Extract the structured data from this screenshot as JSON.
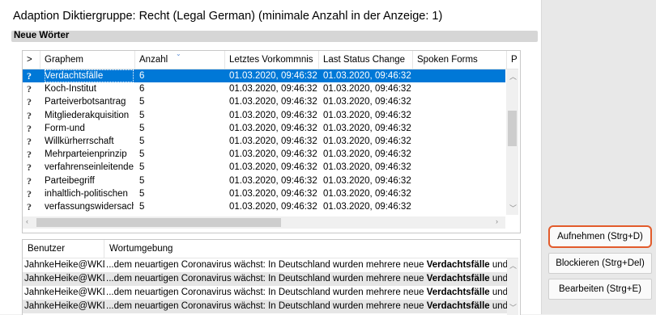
{
  "window": {
    "title": "Adaption Diktiergruppe: Recht (Legal German) (minimale Anzahl in der Anzeige: 1)",
    "section_label": "Neue Wörter"
  },
  "grid": {
    "columns": [
      ">",
      "Graphem",
      "Anzahl",
      "Letztes Vorkommnis",
      "Last Status Change",
      "Spoken Forms",
      "P"
    ],
    "rows": [
      {
        "status": "?",
        "graphem": "Verdachtsfälle",
        "anzahl": "6",
        "letztes": "01.03.2020, 09:46:32",
        "last_change": "01.03.2020, 09:46:32",
        "spoken": ""
      },
      {
        "status": "?",
        "graphem": "Koch-Institut",
        "anzahl": "6",
        "letztes": "01.03.2020, 09:46:32",
        "last_change": "01.03.2020, 09:46:32",
        "spoken": ""
      },
      {
        "status": "?",
        "graphem": "Parteiverbotsantrag",
        "anzahl": "5",
        "letztes": "01.03.2020, 09:46:32",
        "last_change": "01.03.2020, 09:46:32",
        "spoken": ""
      },
      {
        "status": "?",
        "graphem": "Mitgliederakquisition",
        "anzahl": "5",
        "letztes": "01.03.2020, 09:46:32",
        "last_change": "01.03.2020, 09:46:32",
        "spoken": ""
      },
      {
        "status": "?",
        "graphem": "Form-und",
        "anzahl": "5",
        "letztes": "01.03.2020, 09:46:32",
        "last_change": "01.03.2020, 09:46:32",
        "spoken": ""
      },
      {
        "status": "?",
        "graphem": "Willkürherrschaft",
        "anzahl": "5",
        "letztes": "01.03.2020, 09:46:32",
        "last_change": "01.03.2020, 09:46:32",
        "spoken": ""
      },
      {
        "status": "?",
        "graphem": "Mehrparteienprinzip",
        "anzahl": "5",
        "letztes": "01.03.2020, 09:46:32",
        "last_change": "01.03.2020, 09:46:32",
        "spoken": ""
      },
      {
        "status": "?",
        "graphem": "verfahrenseinleitende",
        "anzahl": "5",
        "letztes": "01.03.2020, 09:46:32",
        "last_change": "01.03.2020, 09:46:32",
        "spoken": ""
      },
      {
        "status": "?",
        "graphem": "Parteibegriff",
        "anzahl": "5",
        "letztes": "01.03.2020, 09:46:32",
        "last_change": "01.03.2020, 09:46:32",
        "spoken": ""
      },
      {
        "status": "?",
        "graphem": "inhaltlich-politischen",
        "anzahl": "5",
        "letztes": "01.03.2020, 09:46:32",
        "last_change": "01.03.2020, 09:46:32",
        "spoken": ""
      },
      {
        "status": "?",
        "graphem": "verfassungswidersach",
        "anzahl": "5",
        "letztes": "01.03.2020, 09:46:32",
        "last_change": "01.03.2020, 09:46:32",
        "spoken": ""
      }
    ],
    "selected_index": 0
  },
  "usage": {
    "columns": [
      "Benutzer",
      "Wortumgebung"
    ],
    "rows": [
      {
        "user": "JahnkeHeike@WKD",
        "pre": "...dem neuartigen Coronavirus wächst: In Deutschland wurden mehrere neue ",
        "word": "Verdachtsfälle",
        "post": " und Ir"
      },
      {
        "user": "JahnkeHeike@WKD",
        "pre": "...dem neuartigen Coronavirus wächst: In Deutschland wurden mehrere neue ",
        "word": "Verdachtsfälle",
        "post": " und Ir"
      },
      {
        "user": "JahnkeHeike@WKD",
        "pre": "...dem neuartigen Coronavirus wächst: In Deutschland wurden mehrere neue ",
        "word": "Verdachtsfälle",
        "post": " und Ir"
      },
      {
        "user": "JahnkeHeike@WKD",
        "pre": "...dem neuartigen Coronavirus wächst: In Deutschland wurden mehrere neue ",
        "word": "Verdachtsfälle",
        "post": " und Ir"
      }
    ]
  },
  "buttons": {
    "accept": "Aufnehmen (Strg+D)",
    "block": "Blockieren (Strg+Del)",
    "edit": "Bearbeiten (Strg+E)"
  },
  "icons": {
    "scroll_up": "scroll-up-arrow-icon",
    "scroll_down": "scroll-down-arrow-icon",
    "scroll_left": "scroll-left-arrow-icon",
    "scroll_right": "scroll-right-arrow-icon"
  },
  "colors": {
    "selection": "#0078d7",
    "highlight_border": "#e25b2b"
  }
}
